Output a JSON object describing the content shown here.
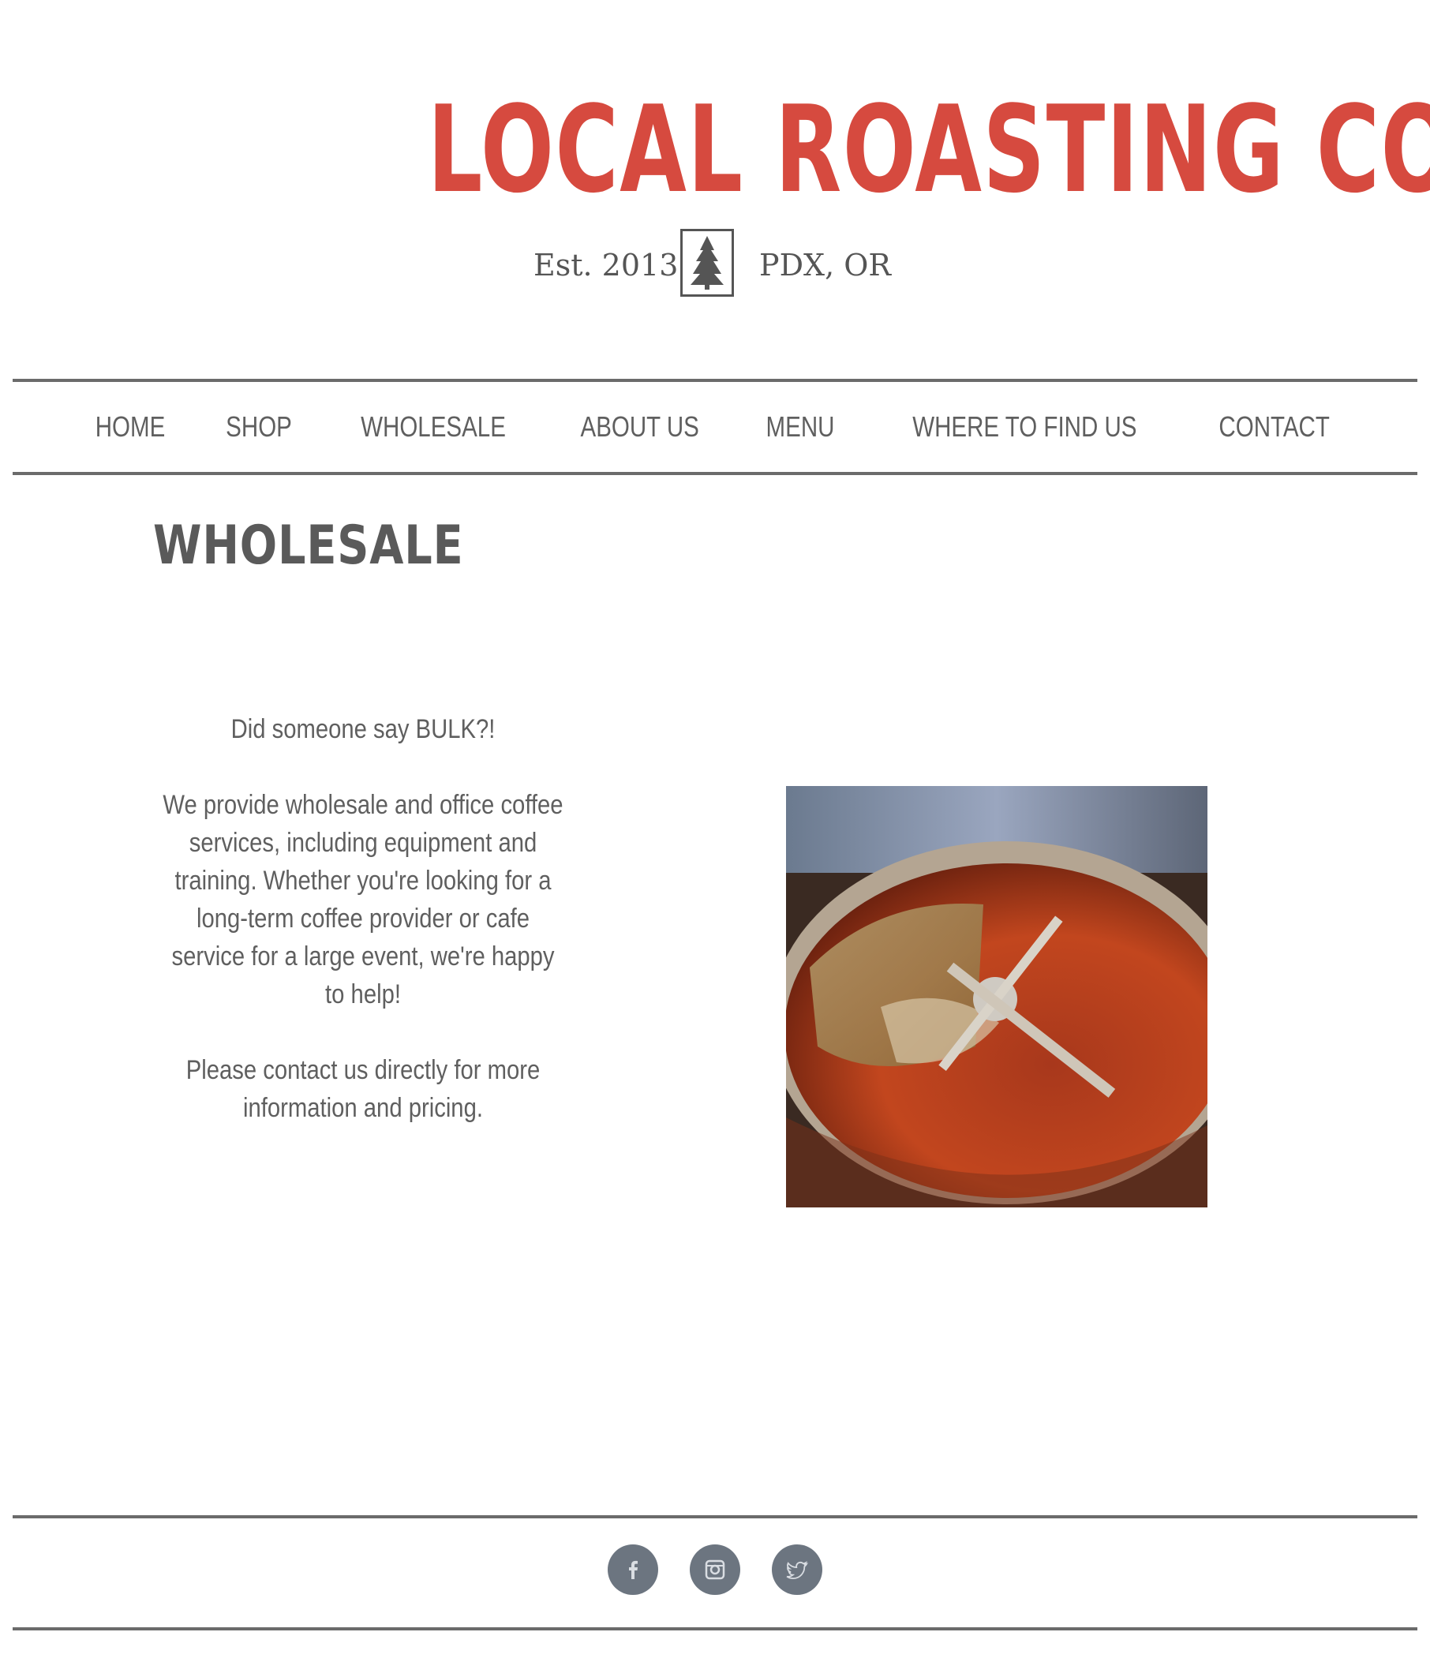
{
  "brand": {
    "name": "LOCAL ROASTING CO.",
    "established": "Est. 2013",
    "location": "PDX, OR",
    "accent_color": "#d64a3f",
    "tree_icon": "pine-tree-icon"
  },
  "nav": {
    "items": [
      {
        "label": "HOME"
      },
      {
        "label": "SHOP"
      },
      {
        "label": "WHOLESALE"
      },
      {
        "label": "ABOUT US"
      },
      {
        "label": "MENU"
      },
      {
        "label": "WHERE TO FIND US"
      },
      {
        "label": "CONTACT"
      }
    ]
  },
  "page": {
    "title": "WHOLESALE",
    "intro": "Did someone say BULK?!",
    "body": "We provide wholesale and office coffee services, including equipment and training. Whether you're looking for a long-term coffee provider or cafe service for a large event, we're happy to help!",
    "contact_note": "Please contact us directly for more information and pricing."
  },
  "photo": {
    "icon": "coffee-roaster-photo"
  },
  "footer": {
    "social": [
      {
        "icon": "facebook-icon"
      },
      {
        "icon": "instagram-icon"
      },
      {
        "icon": "twitter-icon"
      }
    ]
  }
}
